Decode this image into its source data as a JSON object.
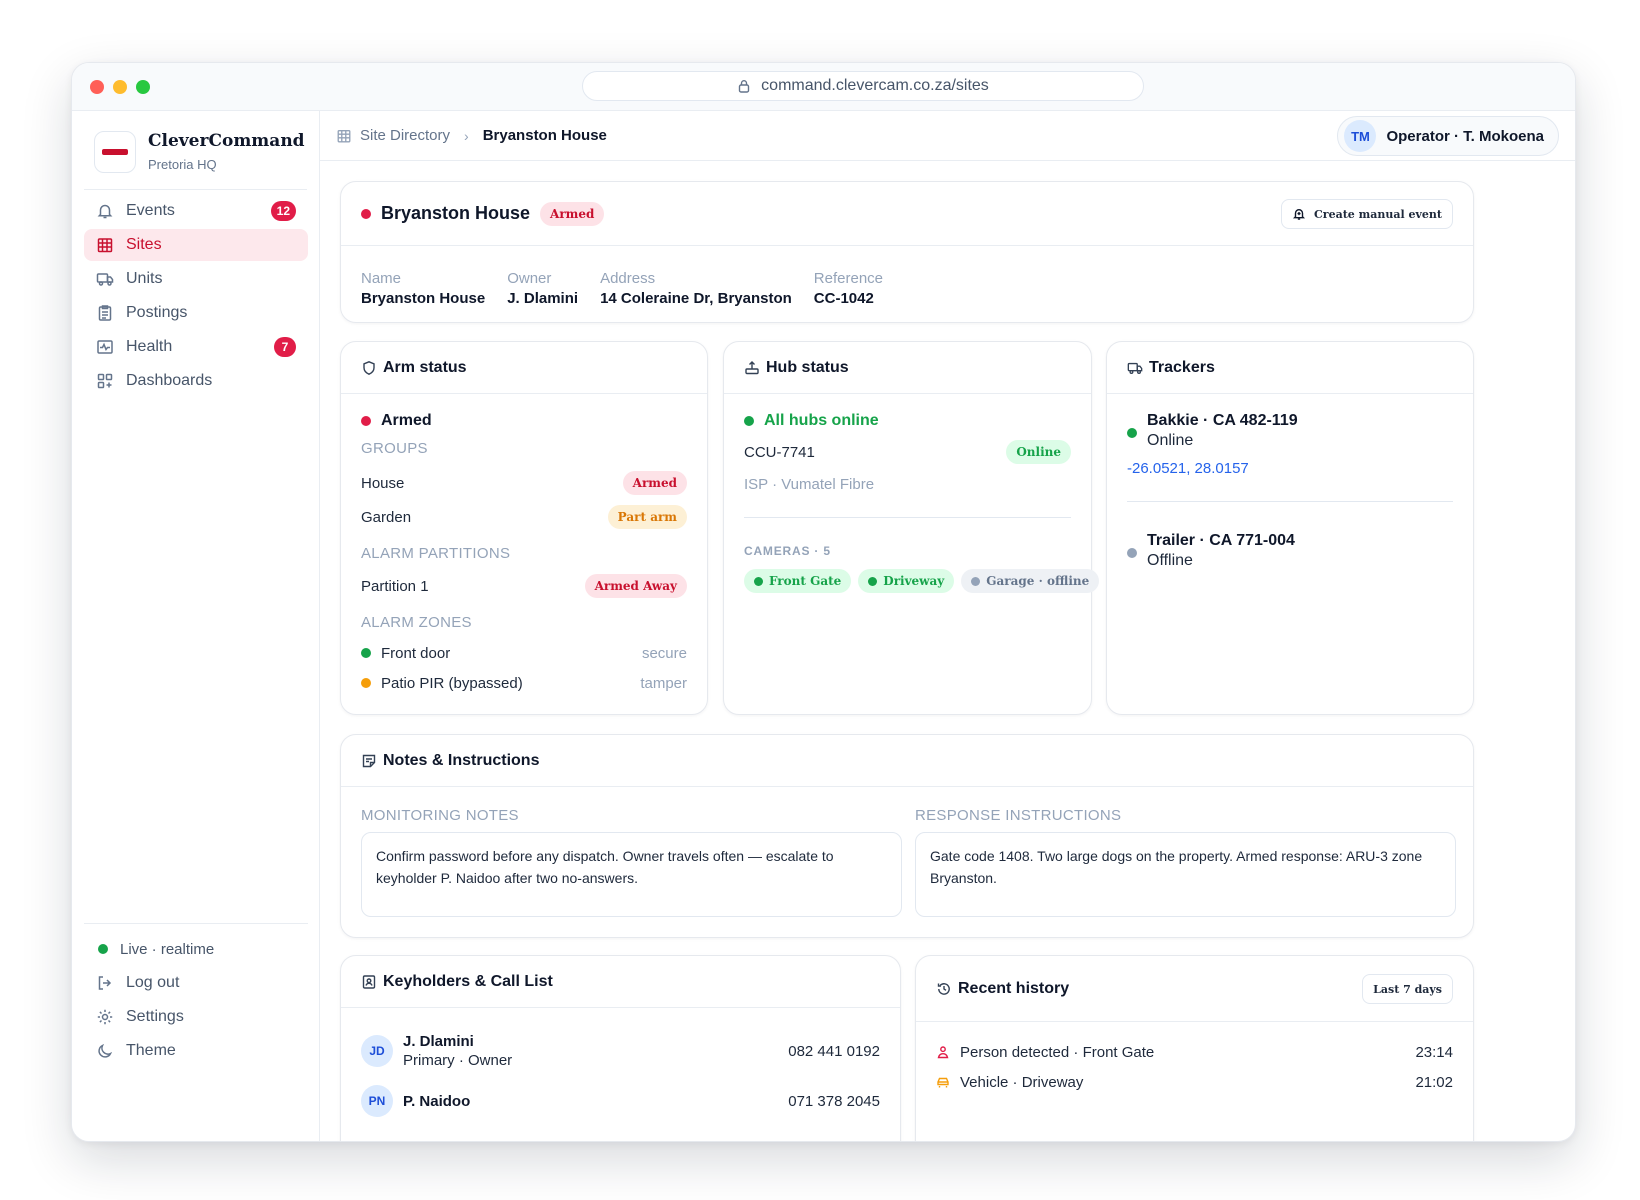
{
  "browser": {
    "url": "command.clevercam.co.za/sites"
  },
  "brand": {
    "name": "CleverCommand",
    "sub": "Pretoria HQ"
  },
  "nav": [
    {
      "label": "Events",
      "icon": "bell-icon",
      "badge": "12",
      "active": false
    },
    {
      "label": "Sites",
      "icon": "building-icon",
      "badge": "",
      "active": true
    },
    {
      "label": "Units",
      "icon": "truck-icon",
      "badge": "",
      "active": false
    },
    {
      "label": "Postings",
      "icon": "clipboard-icon",
      "badge": "",
      "active": false
    },
    {
      "label": "Health",
      "icon": "pulse-icon",
      "badge": "7",
      "active": false
    },
    {
      "label": "Dashboards",
      "icon": "grid-icon",
      "badge": "",
      "active": false
    }
  ],
  "sidebar_bottom": {
    "live": "Live · realtime",
    "logout": "Log out",
    "settings": "Settings",
    "theme": "Theme"
  },
  "breadcrumb": {
    "parent": "Site Directory",
    "current": "Bryanston House"
  },
  "operator": {
    "initials": "TM",
    "label": "Operator · T. Mokoena"
  },
  "site": {
    "title": "Bryanston House",
    "status": "Armed",
    "create_event": "Create manual event",
    "fields": [
      {
        "label": "Name",
        "value": "Bryanston House"
      },
      {
        "label": "Owner",
        "value": "J. Dlamini"
      },
      {
        "label": "Address",
        "value": "14 Coleraine Dr, Bryanston"
      },
      {
        "label": "Reference",
        "value": "CC-1042"
      }
    ]
  },
  "arm": {
    "title": "Arm status",
    "state": "Armed",
    "groups_label": "GROUPS",
    "groups": [
      {
        "name": "House",
        "status": "Armed"
      },
      {
        "name": "Garden",
        "status": "Part arm"
      }
    ],
    "partitions_label": "ALARM PARTITIONS",
    "partitions": [
      {
        "name": "Partition 1",
        "status": "Armed Away"
      }
    ],
    "zones_label": "ALARM ZONES",
    "zones": [
      {
        "name": "Front door",
        "state": "secure"
      },
      {
        "name": "Patio PIR (bypassed)",
        "state": "tamper"
      }
    ]
  },
  "hub": {
    "title": "Hub status",
    "summary": "All hubs online",
    "id": "CCU-7741",
    "id_status": "Online",
    "isp": "ISP · Vumatel Fibre",
    "cameras_label": "CAMERAS · 5",
    "cameras": [
      {
        "name": "Front Gate",
        "online": true
      },
      {
        "name": "Driveway",
        "online": true
      },
      {
        "name": "Garage · offline",
        "online": false
      }
    ]
  },
  "trackers": {
    "title": "Trackers",
    "items": [
      {
        "name": "Bakkie · CA 482-119",
        "status": "Online",
        "coords": "-26.0521, 28.0157"
      },
      {
        "name": "Trailer · CA 771-004",
        "status": "Offline",
        "coords": ""
      }
    ]
  },
  "notes": {
    "title": "Notes & Instructions",
    "monitoring_label": "MONITORING NOTES",
    "monitoring": "Confirm password before any dispatch. Owner travels often — escalate to keyholder P. Naidoo after two no-answers.",
    "response_label": "RESPONSE INSTRUCTIONS",
    "response": "Gate code 1408. Two large dogs on the property. Armed response: ARU-3 zone Bryanston."
  },
  "keyholders": {
    "title": "Keyholders & Call List",
    "items": [
      {
        "initials": "JD",
        "name": "J. Dlamini",
        "role": "Primary · Owner",
        "phone": "082 441 0192"
      },
      {
        "initials": "PN",
        "name": "P. Naidoo",
        "role": "",
        "phone": "071 378 2045"
      }
    ]
  },
  "history": {
    "title": "Recent history",
    "range": "Last 7 days",
    "items": [
      {
        "text": "Person detected · Front Gate",
        "time": "23:14",
        "icon": "person-icon"
      },
      {
        "text": "Vehicle · Driveway",
        "time": "21:02",
        "icon": "car-icon"
      }
    ]
  },
  "colors": {
    "accent": "#c8102e",
    "online": "#16a34a",
    "warning": "#f59e0b",
    "offline": "#94a3b8",
    "link": "#2563eb"
  }
}
